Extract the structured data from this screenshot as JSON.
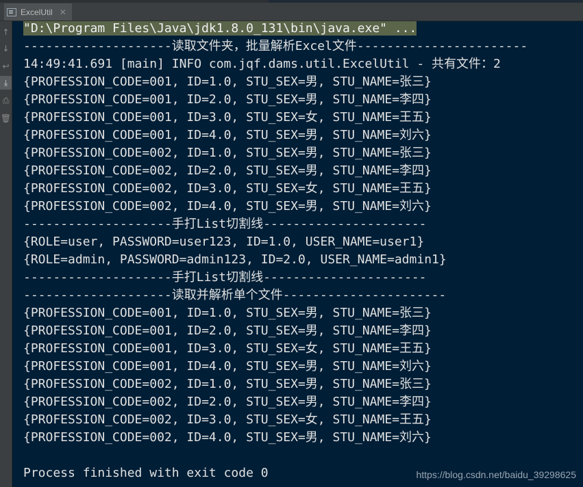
{
  "tab": {
    "title": "ExcelUtil",
    "close_glyph": "✕",
    "icon": "console-tab-icon"
  },
  "gutter": {
    "buttons": [
      {
        "name": "up-arrow-icon",
        "glyph": "↑"
      },
      {
        "name": "down-arrow-icon",
        "glyph": "↓"
      },
      {
        "name": "soft-wrap-icon",
        "glyph": "↩"
      },
      {
        "name": "scroll-to-end-icon",
        "glyph": "⤓"
      },
      {
        "name": "print-icon",
        "glyph": "⎙"
      },
      {
        "name": "trash-icon",
        "glyph": "🗑"
      }
    ]
  },
  "console": {
    "lines": [
      "\"D:\\Program Files\\Java\\jdk1.8.0_131\\bin\\java.exe\" ...",
      "--------------------读取文件夹，批量解析Excel文件-----------------------",
      "14:49:41.691 [main] INFO com.jqf.dams.util.ExcelUtil - 共有文件：2",
      "{PROFESSION_CODE=001, ID=1.0, STU_SEX=男, STU_NAME=张三}",
      "{PROFESSION_CODE=001, ID=2.0, STU_SEX=男, STU_NAME=李四}",
      "{PROFESSION_CODE=001, ID=3.0, STU_SEX=女, STU_NAME=王五}",
      "{PROFESSION_CODE=001, ID=4.0, STU_SEX=男, STU_NAME=刘六}",
      "{PROFESSION_CODE=002, ID=1.0, STU_SEX=男, STU_NAME=张三}",
      "{PROFESSION_CODE=002, ID=2.0, STU_SEX=男, STU_NAME=李四}",
      "{PROFESSION_CODE=002, ID=3.0, STU_SEX=女, STU_NAME=王五}",
      "{PROFESSION_CODE=002, ID=4.0, STU_SEX=男, STU_NAME=刘六}",
      "--------------------手打List切割线----------------------",
      "{ROLE=user, PASSWORD=user123, ID=1.0, USER_NAME=user1}",
      "{ROLE=admin, PASSWORD=admin123, ID=2.0, USER_NAME=admin1}",
      "--------------------手打List切割线----------------------",
      "--------------------读取并解析单个文件----------------------",
      "{PROFESSION_CODE=001, ID=1.0, STU_SEX=男, STU_NAME=张三}",
      "{PROFESSION_CODE=001, ID=2.0, STU_SEX=男, STU_NAME=李四}",
      "{PROFESSION_CODE=001, ID=3.0, STU_SEX=女, STU_NAME=王五}",
      "{PROFESSION_CODE=001, ID=4.0, STU_SEX=男, STU_NAME=刘六}",
      "{PROFESSION_CODE=002, ID=1.0, STU_SEX=男, STU_NAME=张三}",
      "{PROFESSION_CODE=002, ID=2.0, STU_SEX=男, STU_NAME=李四}",
      "{PROFESSION_CODE=002, ID=3.0, STU_SEX=女, STU_NAME=王五}",
      "{PROFESSION_CODE=002, ID=4.0, STU_SEX=男, STU_NAME=刘六}",
      "",
      "Process finished with exit code 0"
    ]
  },
  "watermark": "https://blog.csdn.net/baidu_39298625",
  "colors": {
    "console_bg": "#001e36",
    "text": "#e0e0e0",
    "command_highlight": "#5a6549",
    "sidebar": "#3c3f41"
  }
}
